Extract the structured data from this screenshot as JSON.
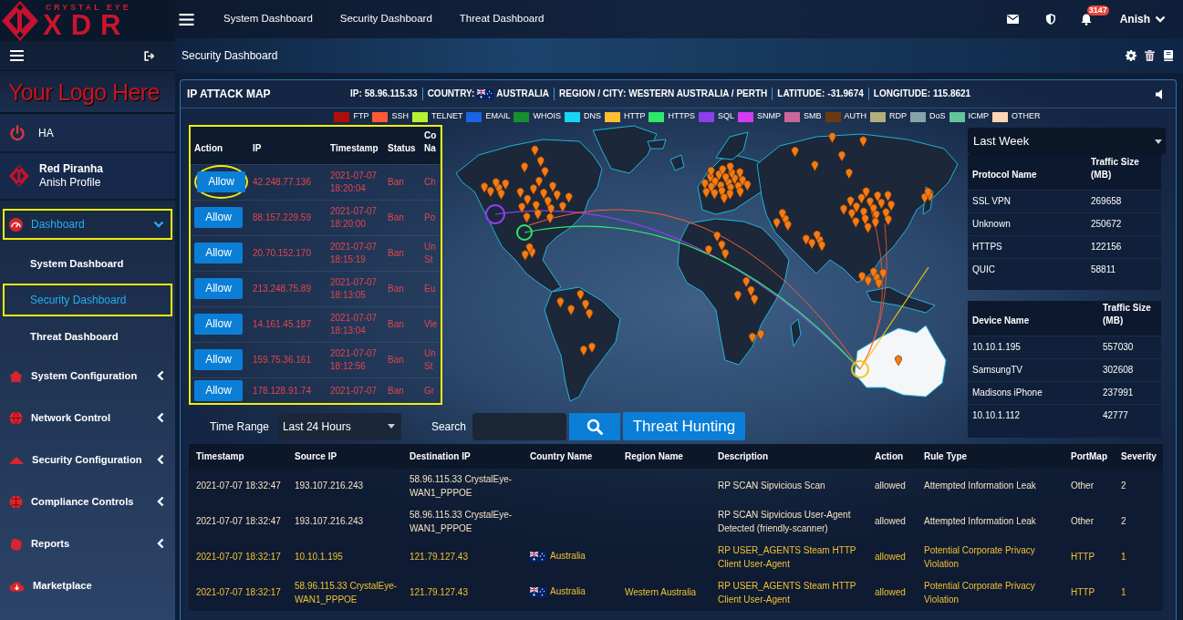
{
  "sidebar": {
    "brand": {
      "tagline": "CRYSTAL EYE",
      "name": "XDR"
    },
    "custom_logo": "Your Logo Here",
    "ha": "HA",
    "profile": {
      "name": "Red Piranha",
      "subtitle": "Anish Profile"
    },
    "nav": [
      {
        "label": "Dashboard",
        "kind": "group",
        "expanded": true,
        "selected": true,
        "highlighted": true,
        "children": [
          {
            "label": "System Dashboard",
            "selected": false,
            "highlighted": false
          },
          {
            "label": "Security Dashboard",
            "selected": true,
            "highlighted": true
          },
          {
            "label": "Threat Dashboard",
            "selected": false,
            "highlighted": false
          }
        ]
      },
      {
        "label": "System Configuration",
        "kind": "group",
        "expanded": false,
        "selected": false,
        "highlighted": false
      },
      {
        "label": "Network Control",
        "kind": "group",
        "expanded": false,
        "selected": false,
        "highlighted": false
      },
      {
        "label": "Security Configuration",
        "kind": "group",
        "expanded": false,
        "selected": false,
        "highlighted": false
      },
      {
        "label": "Compliance Controls",
        "kind": "group",
        "expanded": false,
        "selected": false,
        "highlighted": false
      },
      {
        "label": "Reports",
        "kind": "group",
        "expanded": false,
        "selected": false,
        "highlighted": false
      },
      {
        "label": "Marketplace",
        "kind": "link",
        "selected": false,
        "highlighted": false
      }
    ]
  },
  "topbar": {
    "links": [
      "System Dashboard",
      "Security Dashboard",
      "Threat Dashboard"
    ],
    "notification_count": "3147",
    "user": "Anish"
  },
  "page": {
    "title": "Security Dashboard"
  },
  "attack_map": {
    "title": "IP ATTACK MAP",
    "info": [
      {
        "label": "IP:",
        "value": "58.96.115.33"
      },
      {
        "label": "COUNTRY:",
        "value": "AUSTRALIA",
        "flag": true
      },
      {
        "label": "REGION / CITY:",
        "value": "WESTERN AUSTRALIA / PERTH"
      },
      {
        "label": "LATITUDE:",
        "value": "-31.9674"
      },
      {
        "label": "LONGITUDE:",
        "value": "115.8621"
      }
    ],
    "legend": [
      {
        "label": "FTP",
        "color": "#b00d0d"
      },
      {
        "label": "SSH",
        "color": "#ff5a36"
      },
      {
        "label": "TELNET",
        "color": "#b5f232"
      },
      {
        "label": "EMAIL",
        "color": "#1a63e6"
      },
      {
        "label": "WHOIS",
        "color": "#14912c"
      },
      {
        "label": "DNS",
        "color": "#17d4f5"
      },
      {
        "label": "HTTP",
        "color": "#fcc02e"
      },
      {
        "label": "HTTPS",
        "color": "#2fe86a"
      },
      {
        "label": "SQL",
        "color": "#8b3ff0"
      },
      {
        "label": "SNMP",
        "color": "#d43cf0"
      },
      {
        "label": "SMB",
        "color": "#cc6699"
      },
      {
        "label": "AUTH",
        "color": "#6b3a12"
      },
      {
        "label": "RDP",
        "color": "#b3ae7b"
      },
      {
        "label": "DoS",
        "color": "#86a3ab"
      },
      {
        "label": "ICMP",
        "color": "#63c59b"
      },
      {
        "label": "OTHER",
        "color": "#fcd6b4"
      }
    ]
  },
  "attack_log": {
    "highlighted": true,
    "columns": [
      "Action",
      "IP",
      "Timestamp",
      "Status",
      "Co Na"
    ],
    "rows": [
      {
        "action": "Allow",
        "ip": "42.248.77.136",
        "timestamp": "2021-07-07 18:20:04",
        "status": "Ban",
        "country": "Ch",
        "circled": true
      },
      {
        "action": "Allow",
        "ip": "88.157.229.59",
        "timestamp": "2021-07-07 18:20:00",
        "status": "Ban",
        "country": "Po",
        "circled": false
      },
      {
        "action": "Allow",
        "ip": "20.70.152.170",
        "timestamp": "2021-07-07 18:15:19",
        "status": "Ban",
        "country": "Un St",
        "circled": false
      },
      {
        "action": "Allow",
        "ip": "213.248.75.89",
        "timestamp": "2021-07-07 18:13:05",
        "status": "Ban",
        "country": "Eu",
        "circled": false
      },
      {
        "action": "Allow",
        "ip": "14.161.45.187",
        "timestamp": "2021-07-07 18:13:04",
        "status": "Ban",
        "country": "Vie",
        "circled": false
      },
      {
        "action": "Allow",
        "ip": "159.75.36.161",
        "timestamp": "2021-07-07 18:12:56",
        "status": "Ban",
        "country": "Un St",
        "circled": false
      },
      {
        "action": "Allow",
        "ip": "178.128.91.74",
        "timestamp": "2021-07-07",
        "status": "Ban",
        "country": "Gr",
        "circled": false
      }
    ]
  },
  "traffic": {
    "period": "Last Week",
    "protocols": {
      "columns": [
        "Protocol Name",
        "Traffic Size (MB)"
      ],
      "rows": [
        {
          "name": "SSL VPN",
          "size": "269658"
        },
        {
          "name": "Unknown",
          "size": "250672"
        },
        {
          "name": "HTTPS",
          "size": "122156"
        },
        {
          "name": "QUIC",
          "size": "58811"
        }
      ]
    },
    "devices": {
      "columns": [
        "Device Name",
        "Traffic Size (MB)"
      ],
      "rows": [
        {
          "name": "10.10.1.195",
          "size": "557030"
        },
        {
          "name": "SamsungTV",
          "size": "302608"
        },
        {
          "name": "Madisons iPhone",
          "size": "237991"
        },
        {
          "name": "10.10.1.112",
          "size": "42777"
        }
      ]
    }
  },
  "filters": {
    "time_range_label": "Time Range",
    "time_range": "Last 24 Hours",
    "search_label": "Search",
    "threat_hunting": "Threat Hunting"
  },
  "events": {
    "columns": [
      "Timestamp",
      "Source IP",
      "Destination IP",
      "Country Name",
      "Region Name",
      "Description",
      "Action",
      "Rule Type",
      "PortMap",
      "Severity"
    ],
    "rows": [
      {
        "timestamp": "2021-07-07 18:32:47",
        "source_ip": "193.107.216.243",
        "destination_ip": "58.96.115.33 CrystalEye-WAN1_PPPOE",
        "description": "RP SCAN Sipvicious Scan",
        "action": "allowed",
        "rule_type": "Attempted Information Leak",
        "portmap": "Other",
        "severity": "2",
        "color": "#f5e2c4"
      },
      {
        "timestamp": "2021-07-07 18:32:47",
        "source_ip": "193.107.216.243",
        "destination_ip": "58.96.115.33 CrystalEye-WAN1_PPPOE",
        "description": "RP SCAN Sipvicious User-Agent Detected (friendly-scanner)",
        "action": "allowed",
        "rule_type": "Attempted Information Leak",
        "portmap": "Other",
        "severity": "2",
        "color": "#f5e2c4"
      },
      {
        "timestamp": "2021-07-07 18:32:17",
        "source_ip": "10.10.1.195",
        "destination_ip": "121.79.127.43",
        "country": "Australia",
        "description": "RP USER_AGENTS Steam HTTP Client User-Agent",
        "action": "allowed",
        "rule_type": "Potential Corporate Privacy Violation",
        "portmap": "HTTP",
        "severity": "1",
        "color": "#f2c232"
      },
      {
        "timestamp": "2021-07-07 18:32:17",
        "source_ip": "58.96.115.33 CrystalEye-WAN1_PPPOE",
        "destination_ip": "121.79.127.43",
        "country": "Australia",
        "region": "Western Australia",
        "description": "RP USER_AGENTS Steam HTTP Client User-Agent",
        "action": "allowed",
        "rule_type": "Potential Corporate Privacy Violation",
        "portmap": "HTTP",
        "severity": "1",
        "color": "#f2c232"
      }
    ]
  }
}
